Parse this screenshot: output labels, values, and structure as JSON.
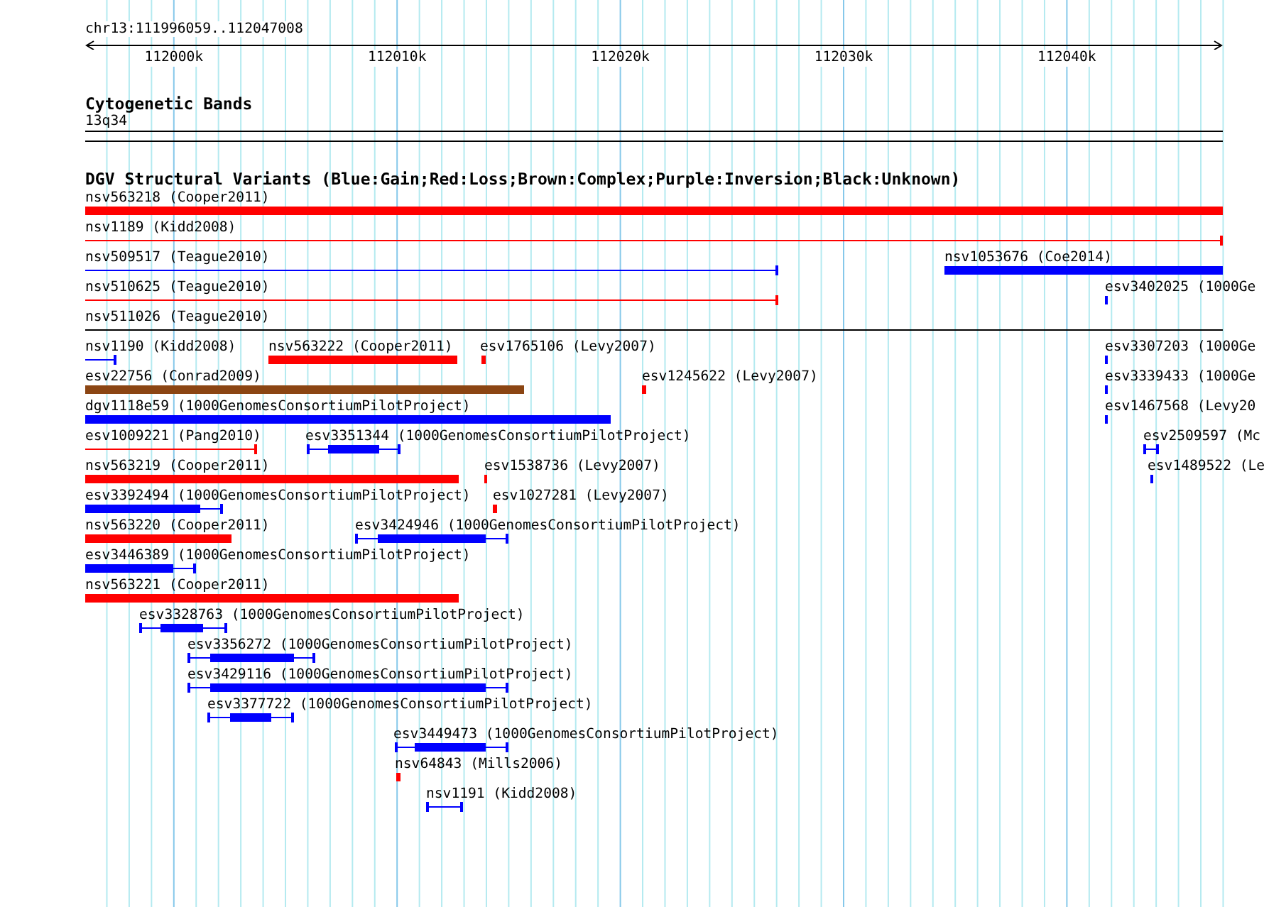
{
  "ruler": {
    "label": "chr13:111996059..112047008",
    "ticks": [
      "112000k",
      "112010k",
      "112020k",
      "112030k",
      "112040k"
    ]
  },
  "cytogenetic_track": {
    "title": "Cytogenetic Bands",
    "band": "13q34"
  },
  "dgv_track": {
    "title": "DGV Structural Variants (Blue:Gain;Red:Loss;Brown:Complex;Purple:Inversion;Black:Unknown)",
    "rows": [
      {
        "features": [
          {
            "label": "nsv563218 (Cooper2011)",
            "kind": "loss"
          }
        ]
      },
      {
        "features": [
          {
            "label": "nsv1189 (Kidd2008)",
            "kind": "loss"
          }
        ]
      },
      {
        "features": [
          {
            "label": "nsv509517 (Teague2010)",
            "kind": "gain"
          },
          {
            "label": "nsv1053676 (Coe2014)",
            "kind": "gain"
          }
        ]
      },
      {
        "features": [
          {
            "label": "nsv510625 (Teague2010)",
            "kind": "loss"
          },
          {
            "label": "esv3402025 (1000Ge",
            "kind": "gain"
          }
        ]
      },
      {
        "features": [
          {
            "label": "nsv511026 (Teague2010)",
            "kind": "unknown"
          }
        ]
      },
      {
        "features": [
          {
            "label": "nsv1190 (Kidd2008)",
            "kind": "gain"
          },
          {
            "label": "nsv563222 (Cooper2011)",
            "kind": "loss"
          },
          {
            "label": "esv1765106 (Levy2007)",
            "kind": "loss"
          },
          {
            "label": "esv3307203 (1000Ge",
            "kind": "gain"
          }
        ]
      },
      {
        "features": [
          {
            "label": "esv22756 (Conrad2009)",
            "kind": "complex"
          },
          {
            "label": "esv1245622 (Levy2007)",
            "kind": "loss"
          },
          {
            "label": "esv3339433 (1000Ge",
            "kind": "gain"
          }
        ]
      },
      {
        "features": [
          {
            "label": "dgv1118e59 (1000GenomesConsortiumPilotProject)",
            "kind": "gain"
          },
          {
            "label": "esv1467568 (Levy20",
            "kind": "gain"
          }
        ]
      },
      {
        "features": [
          {
            "label": "esv1009221 (Pang2010)",
            "kind": "loss"
          },
          {
            "label": "esv3351344 (1000GenomesConsortiumPilotProject)",
            "kind": "gain"
          },
          {
            "label": "esv2509597 (Mc",
            "kind": "gain"
          }
        ]
      },
      {
        "features": [
          {
            "label": "nsv563219 (Cooper2011)",
            "kind": "loss"
          },
          {
            "label": "esv1538736 (Levy2007)",
            "kind": "loss"
          },
          {
            "label": "esv1489522 (Le",
            "kind": "gain"
          }
        ]
      },
      {
        "features": [
          {
            "label": "esv3392494 (1000GenomesConsortiumPilotProject)",
            "kind": "gain"
          },
          {
            "label": "esv1027281 (Levy2007)",
            "kind": "loss"
          }
        ]
      },
      {
        "features": [
          {
            "label": "nsv563220 (Cooper2011)",
            "kind": "loss"
          },
          {
            "label": "esv3424946 (1000GenomesConsortiumPilotProject)",
            "kind": "gain"
          }
        ]
      },
      {
        "features": [
          {
            "label": "esv3446389 (1000GenomesConsortiumPilotProject)",
            "kind": "gain"
          }
        ]
      },
      {
        "features": [
          {
            "label": "nsv563221 (Cooper2011)",
            "kind": "loss"
          }
        ]
      },
      {
        "features": [
          {
            "label": "esv3328763 (1000GenomesConsortiumPilotProject)",
            "kind": "gain"
          }
        ]
      },
      {
        "features": [
          {
            "label": "esv3356272 (1000GenomesConsortiumPilotProject)",
            "kind": "gain"
          }
        ]
      },
      {
        "features": [
          {
            "label": "esv3429116 (1000GenomesConsortiumPilotProject)",
            "kind": "gain"
          }
        ]
      },
      {
        "features": [
          {
            "label": "esv3377722 (1000GenomesConsortiumPilotProject)",
            "kind": "gain"
          }
        ]
      },
      {
        "features": [
          {
            "label": "esv3449473 (1000GenomesConsortiumPilotProject)",
            "kind": "gain"
          }
        ]
      },
      {
        "features": [
          {
            "label": "nsv64843 (Mills2006)",
            "kind": "loss"
          }
        ]
      },
      {
        "features": [
          {
            "label": "nsv1191 (Kidd2008)",
            "kind": "gain"
          }
        ]
      }
    ]
  }
}
